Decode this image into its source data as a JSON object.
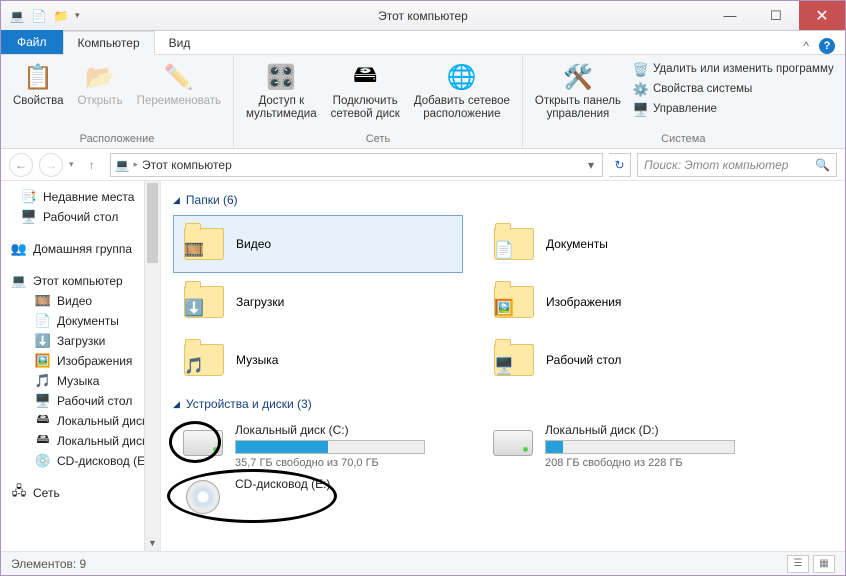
{
  "window": {
    "title": "Этот компьютер"
  },
  "tabs": {
    "file": "Файл",
    "computer": "Компьютер",
    "view": "Вид"
  },
  "ribbon": {
    "properties": "Свойства",
    "open": "Открыть",
    "rename": "Переименовать",
    "group_location": "Расположение",
    "media": "Доступ к\nмультимедиа",
    "netdrive": "Подключить\nсетевой диск",
    "netloc": "Добавить сетевое\nрасположение",
    "group_network": "Сеть",
    "cpanel": "Открыть панель\nуправления",
    "uninstall": "Удалить или изменить программу",
    "sysprops": "Свойства системы",
    "manage": "Управление",
    "group_system": "Система"
  },
  "nav": {
    "breadcrumb": "Этот компьютер",
    "search_placeholder": "Поиск: Этот компьютер"
  },
  "sidebar": {
    "recent": "Недавние места",
    "desktop": "Рабочий стол",
    "homegroup": "Домашняя группа",
    "thispc": "Этот компьютер",
    "children": {
      "video": "Видео",
      "docs": "Документы",
      "downloads": "Загрузки",
      "pictures": "Изображения",
      "music": "Музыка",
      "desk": "Рабочий стол",
      "localc": "Локальный диск",
      "locald": "Локальный диск",
      "cd": "CD-дисковод (E:"
    },
    "network": "Сеть"
  },
  "sections": {
    "folders": "Папки (6)",
    "devices": "Устройства и диски (3)"
  },
  "folders": {
    "video": "Видео",
    "docs": "Документы",
    "downloads": "Загрузки",
    "pictures": "Изображения",
    "music": "Музыка",
    "desktop": "Рабочий стол"
  },
  "drives": {
    "c": {
      "name": "Локальный диск (C:)",
      "free": "35,7 ГБ свободно из 70,0 ГБ",
      "fill": 49
    },
    "d": {
      "name": "Локальный диск (D:)",
      "free": "208 ГБ свободно из 228 ГБ",
      "fill": 9
    },
    "e": {
      "name": "CD-дисковод (E:)"
    }
  },
  "status": {
    "items": "Элементов: 9"
  }
}
